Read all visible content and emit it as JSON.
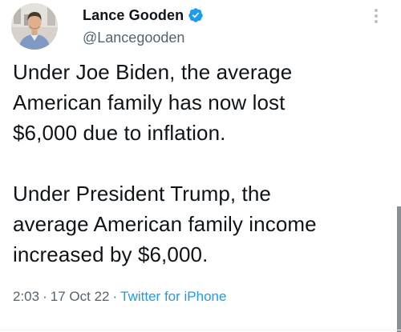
{
  "author": {
    "display_name": "Lance Gooden",
    "handle": "@Lancegooden",
    "verified": true,
    "verified_color": "#1d9bf0",
    "avatar": "profile-photo"
  },
  "tweet": {
    "paragraphs": [
      [
        "Under Joe Biden, the average",
        "American family has now lost",
        "$6,000 due to inflation."
      ],
      [
        "Under President Trump, the",
        "average American family income",
        "increased by $6,000."
      ]
    ]
  },
  "meta": {
    "time": "2:03",
    "date": "17 Oct 22",
    "separator": "·",
    "source": "Twitter for iPhone",
    "source_color": "#1d9bf0"
  },
  "icons": {
    "more": "more-options-icon",
    "verified": "verified-badge-icon"
  }
}
